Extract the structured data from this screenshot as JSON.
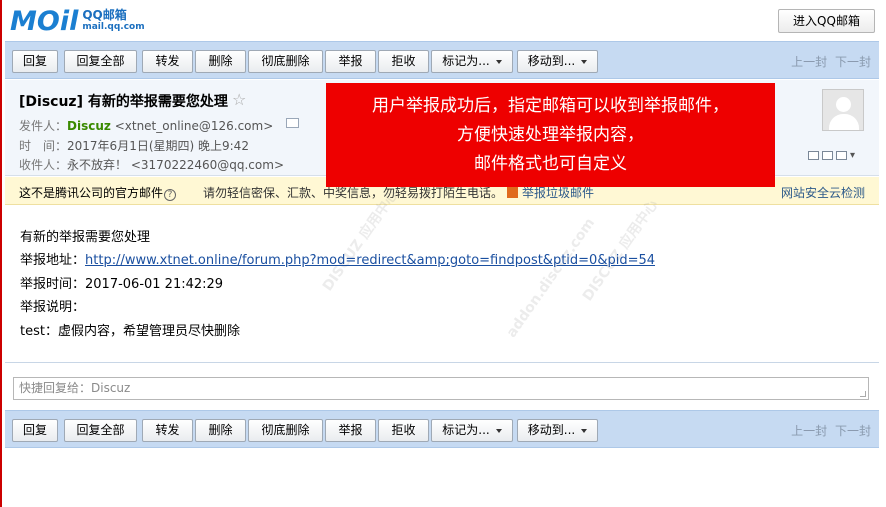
{
  "header": {
    "logo_word": "MOil",
    "logo_line1": "QQ邮箱",
    "logo_line2": "mail.qq.com",
    "enter_button": "进入QQ邮箱"
  },
  "toolbar": {
    "reply": "回复",
    "reply_all": "回复全部",
    "forward": "转发",
    "delete": "删除",
    "delete_permanently": "彻底删除",
    "report": "举报",
    "reject": "拒收",
    "mark_as": "标记为...",
    "move_to": "移动到...",
    "prev": "上一封",
    "next": "下一封"
  },
  "message": {
    "subject": "[Discuz] 有新的举报需要您处理",
    "star": "☆",
    "from_label": "发件人：",
    "from_name": "Discuz",
    "from_addr": "<xtnet_online@126.com>",
    "time_label": "时　间：",
    "time_value": "2017年6月1日(星期四) 晚上9:42",
    "to_label": "收件人：",
    "to_name": "永不放弃！",
    "to_addr": "<3170222460@qq.com>"
  },
  "notice": {
    "not_official": "这不是腾讯公司的官方邮件",
    "qmark": "?",
    "warning": "请勿轻信密保、汇款、中奖信息，勿轻易拨打陌生电话。",
    "report_spam": "举报垃圾邮件",
    "safety_check": "网站安全云检测"
  },
  "overlay": {
    "line1": "用户举报成功后，指定邮箱可以收到举报邮件，",
    "line2": "方便快速处理举报内容，",
    "line3": "邮件格式也可自定义"
  },
  "mail_body": {
    "line1": "有新的举报需要您处理",
    "addr_label": "举报地址：",
    "addr_link": "http://www.xtnet.online/forum.php?mod=redirect&amp;goto=findpost&ptid=0&pid=54",
    "time_line": "举报时间：2017-06-01 21:42:29",
    "desc_label": "举报说明：",
    "desc_value": "test：虚假内容，希望管理员尽快删除"
  },
  "watermark": {
    "text1": "DISCUZ 应用中心",
    "text2": "addon.discuz.com"
  },
  "quick_reply": {
    "placeholder": "快捷回复给：Discuz"
  },
  "colors": {
    "toolbar_bg": "#c6daf2",
    "overlay_red": "#ee0000",
    "sender_green": "#3a8a00",
    "link_blue": "#1a4fa0",
    "notice_bg": "#fff8d4"
  }
}
